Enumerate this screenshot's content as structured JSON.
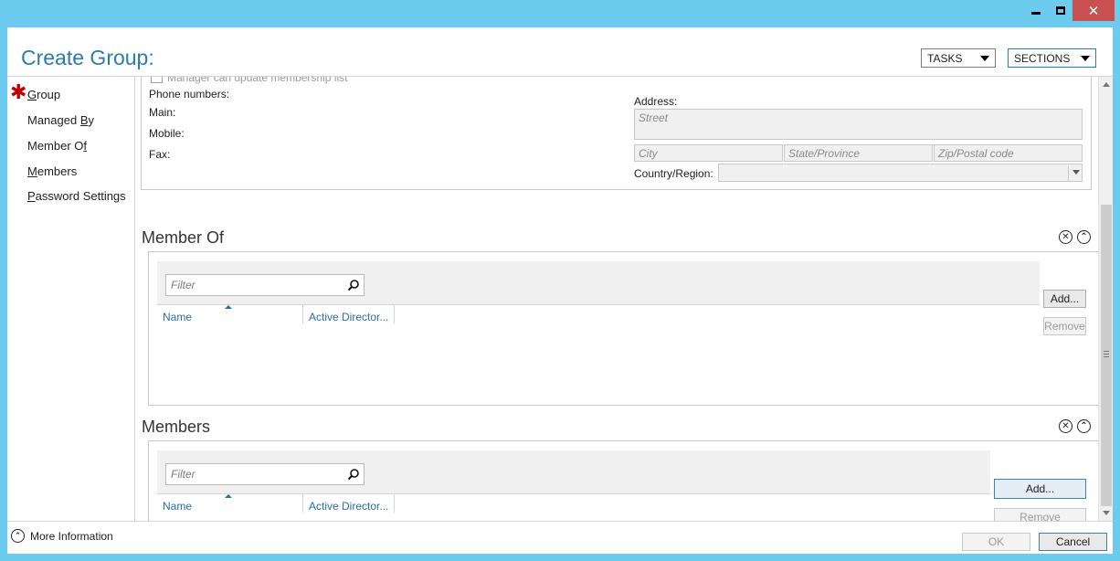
{
  "window": {
    "minimize_glyph": "",
    "maximize_glyph": "",
    "close_glyph": "✕"
  },
  "header": {
    "title": "Create Group:",
    "tasks_label": "TASKS",
    "sections_label": "SECTIONS"
  },
  "nav": {
    "required_marker": "✱",
    "items": [
      {
        "pre": "",
        "accel": "G",
        "post": "roup"
      },
      {
        "pre": "Managed ",
        "accel": "B",
        "post": "y"
      },
      {
        "pre": "Member O",
        "accel": "f",
        "post": ""
      },
      {
        "pre": "",
        "accel": "M",
        "post": "embers"
      },
      {
        "pre": "",
        "accel": "P",
        "post": "assword Settings"
      }
    ]
  },
  "general": {
    "manager_checkbox_label": "Manager can update membership list",
    "phone_numbers_label": "Phone numbers:",
    "main_label": "Main:",
    "mobile_label": "Mobile:",
    "fax_label": "Fax:",
    "address_label": "Address:",
    "street_placeholder": "Street",
    "city_placeholder": "City",
    "state_placeholder": "State/Province",
    "zip_placeholder": "Zip/Postal code",
    "country_label": "Country/Region:"
  },
  "member_of": {
    "title": "Member Of",
    "close_glyph": "✕",
    "collapse_glyph": "⌃",
    "filter_placeholder": "Filter",
    "columns": [
      "Name",
      "Active Director..."
    ],
    "add_label": "Add...",
    "remove_label": "Remove"
  },
  "members": {
    "title": "Members",
    "close_glyph": "✕",
    "collapse_glyph": "⌃",
    "filter_placeholder": "Filter",
    "columns": [
      "Name",
      "Active Director..."
    ],
    "add_label": "Add...",
    "remove_label": "Remove"
  },
  "footer": {
    "more_info_glyph": "⌃",
    "more_info_label": "More Information",
    "ok_label": "OK",
    "cancel_label": "Cancel"
  },
  "colors": {
    "window_frame": "#6ccbee",
    "title_blue": "#2b7cab",
    "close_button": "#c75050",
    "required_star": "#c00000"
  }
}
